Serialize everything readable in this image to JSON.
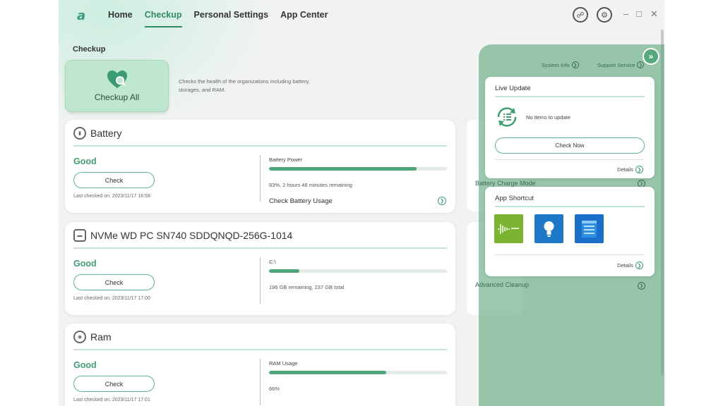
{
  "app": {
    "logo": "a"
  },
  "nav": {
    "items": [
      "Home",
      "Checkup",
      "Personal Settings",
      "App Center"
    ],
    "active": "Checkup"
  },
  "section_title": "Checkup",
  "checkup_all": {
    "label": "Checkup All",
    "description": "Checks the health of the organizations including battery, storages, and RAM."
  },
  "cards": [
    {
      "title": "Battery",
      "status": "Good",
      "check_label": "Check",
      "last_checked": "Last checked on: 2023/11/17 16:58",
      "metric_label": "Battery Power",
      "progress": 0.83,
      "metric_sub": "83%, 2 hours 48 minutes remaining",
      "link": "Check Battery Usage"
    },
    {
      "title": "NVMe WD PC SN740 SDDQNQD-256G-1014",
      "status": "Good",
      "check_label": "Check",
      "last_checked": "Last checked on: 2023/11/17 17:00",
      "metric_label": "C:\\",
      "progress": 0.17,
      "metric_sub": "196 GB remaining, 237 GB total"
    },
    {
      "title": "Ram",
      "status": "Good",
      "check_label": "Check",
      "last_checked": "Last checked on: 2023/11/17 17:01",
      "metric_label": "RAM Usage",
      "progress": 0.66,
      "metric_sub": "66%"
    }
  ],
  "side": {
    "system_info": "System Info",
    "support_service": "Support Service",
    "live_update": {
      "title": "Live Update",
      "message": "No items to update",
      "button": "Check Now",
      "details": "Details"
    },
    "app_shortcut": {
      "title": "App Shortcut",
      "details": "Details",
      "apps": [
        {
          "icon": "audio-app-icon",
          "color": "#7ab430"
        },
        {
          "icon": "lightbulb-app-icon",
          "color": "#1e78c8"
        },
        {
          "icon": "folder-app-icon",
          "color": "#1a6fc8"
        }
      ]
    },
    "bg_labels": {
      "charge_mode": "Battery Charge Mode",
      "advanced_cleanup": "Advanced Cleanup"
    }
  },
  "colors": {
    "accent": "#3fa070",
    "overlay": "#5ea87e"
  }
}
